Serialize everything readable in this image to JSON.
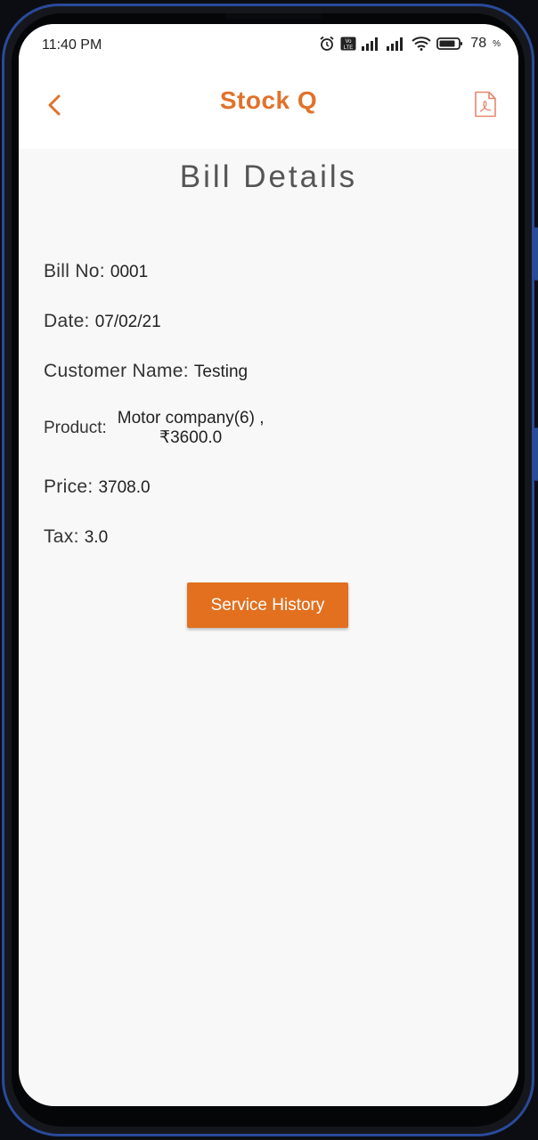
{
  "status_bar": {
    "time": "11:40 PM",
    "battery": "78",
    "battery_unit": "%",
    "icons": [
      "alarm-icon",
      "volte-icon",
      "signal-icon",
      "signal-icon",
      "wifi-icon",
      "battery-icon"
    ]
  },
  "app_bar": {
    "title": "Stock Q",
    "accent_color": "#e2712a",
    "back_icon": "chevron-left-icon",
    "pdf_icon": "pdf-file-icon"
  },
  "main": {
    "heading": "Bill Details",
    "bill_no": {
      "label": "Bill No:",
      "value": "0001"
    },
    "date": {
      "label": "Date:",
      "value": "07/02/21"
    },
    "customer": {
      "label": "Customer Name:",
      "value": "Testing"
    },
    "product": {
      "label": "Product:",
      "value_line1": "Motor company(6) ,",
      "value_line2": "₹3600.0"
    },
    "price": {
      "label": "Price:",
      "value": "3708.0"
    },
    "tax": {
      "label": "Tax:",
      "value": "3.0"
    },
    "service_button": "Service History",
    "button_color": "#e2701f"
  }
}
